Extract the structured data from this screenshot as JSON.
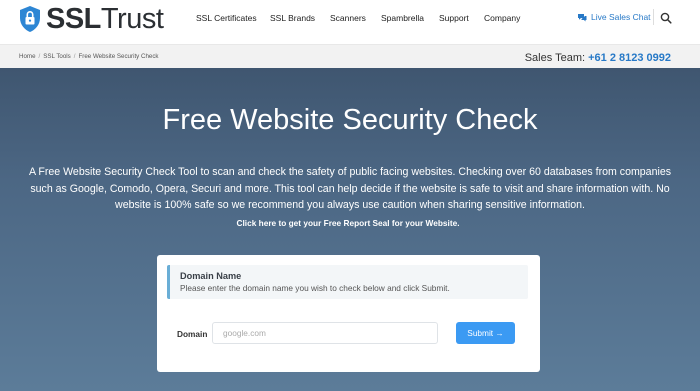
{
  "brand": {
    "name_bold": "SSL",
    "name_thin": "Trust"
  },
  "nav": {
    "items": [
      {
        "label": "SSL Certificates"
      },
      {
        "label": "SSL Brands"
      },
      {
        "label": "Scanners"
      },
      {
        "label": "Spambrella"
      },
      {
        "label": "Support"
      },
      {
        "label": "Company"
      }
    ],
    "chat_label": "Live Sales Chat",
    "icons": {
      "chat": "chat-bubble-icon",
      "search": "search-icon",
      "logo": "shield-lock-icon"
    }
  },
  "breadcrumb": {
    "items": [
      "Home",
      "SSL Tools",
      "Free Website Security Check"
    ],
    "separator": "/"
  },
  "sales": {
    "label": "Sales Team:",
    "phone": "+61 2 8123 0992"
  },
  "hero": {
    "title": "Free Website Security Check",
    "description": "A Free Website Security Check Tool to scan and check the safety of public facing websites. Checking over 60 databases from companies such as Google, Comodo, Opera, Securi and more. This tool can help decide if the website is safe to visit and share information with. No website is 100% safe so we recommend you always use caution when sharing sensitive information.",
    "link_text": "Click here to get your Free Report Seal for your Website."
  },
  "form": {
    "alert_title": "Domain Name",
    "alert_text": "Please enter the domain name you wish to check below and click Submit.",
    "field_label": "Domain",
    "input_value": "",
    "input_placeholder": "google.com",
    "submit_label": "Submit →"
  },
  "colors": {
    "accent_blue": "#2779c7",
    "button_blue": "#3b9af3",
    "hero_top": "#3f5670",
    "hero_bottom": "#5c7c99",
    "logo_shield": "#2d86d4"
  }
}
